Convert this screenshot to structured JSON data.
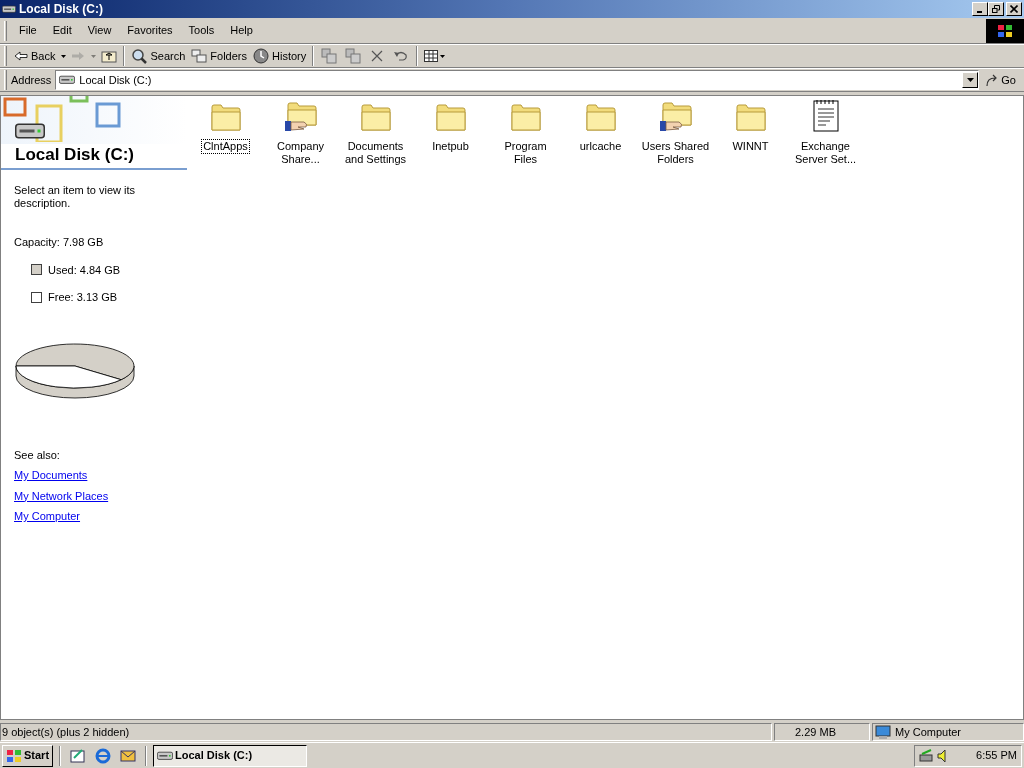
{
  "window": {
    "title": "Local Disk (C:)"
  },
  "menu": [
    "File",
    "Edit",
    "View",
    "Favorites",
    "Tools",
    "Help"
  ],
  "toolbar": {
    "back": "Back",
    "search": "Search",
    "folders": "Folders",
    "history": "History",
    "forward_disabled": true
  },
  "address": {
    "label": "Address",
    "value": "Local Disk (C:)",
    "go": "Go"
  },
  "info_pane": {
    "title": "Local Disk (C:)",
    "description": "Select an item to view its description.",
    "capacity": "Capacity: 7.98 GB",
    "legend": [
      {
        "text": "Used: 4.84 GB",
        "color": "#d4d0c8"
      },
      {
        "text": "Free: 3.13 GB",
        "color": "#ffffff"
      }
    ],
    "usage_pie": {
      "level": 0.607
    },
    "see_also": "See also:",
    "links": [
      "My Documents",
      "My Network Places",
      "My Computer"
    ]
  },
  "items": [
    {
      "name": "ClntApps",
      "kind": "folder",
      "selected": true
    },
    {
      "name": "Company Share...",
      "kind": "shared_folder",
      "selected": false
    },
    {
      "name": "Documents and Settings",
      "kind": "folder",
      "selected": false
    },
    {
      "name": "Inetpub",
      "kind": "folder",
      "selected": false
    },
    {
      "name": "Program Files",
      "kind": "folder",
      "selected": false
    },
    {
      "name": "urlcache",
      "kind": "folder",
      "selected": false
    },
    {
      "name": "Users Shared Folders",
      "kind": "shared_folder",
      "selected": false
    },
    {
      "name": "WINNT",
      "kind": "folder",
      "selected": false
    },
    {
      "name": "Exchange Server Set...",
      "kind": "document",
      "selected": false
    }
  ],
  "status_bar": {
    "objects": "9 object(s) (plus 2 hidden)",
    "size": "2.29 MB",
    "zone": "My Computer"
  },
  "taskbar": {
    "start": "Start",
    "tasks": [
      {
        "label": "Local Disk (C:)",
        "selected": true
      }
    ],
    "clock": "6:55 PM"
  }
}
